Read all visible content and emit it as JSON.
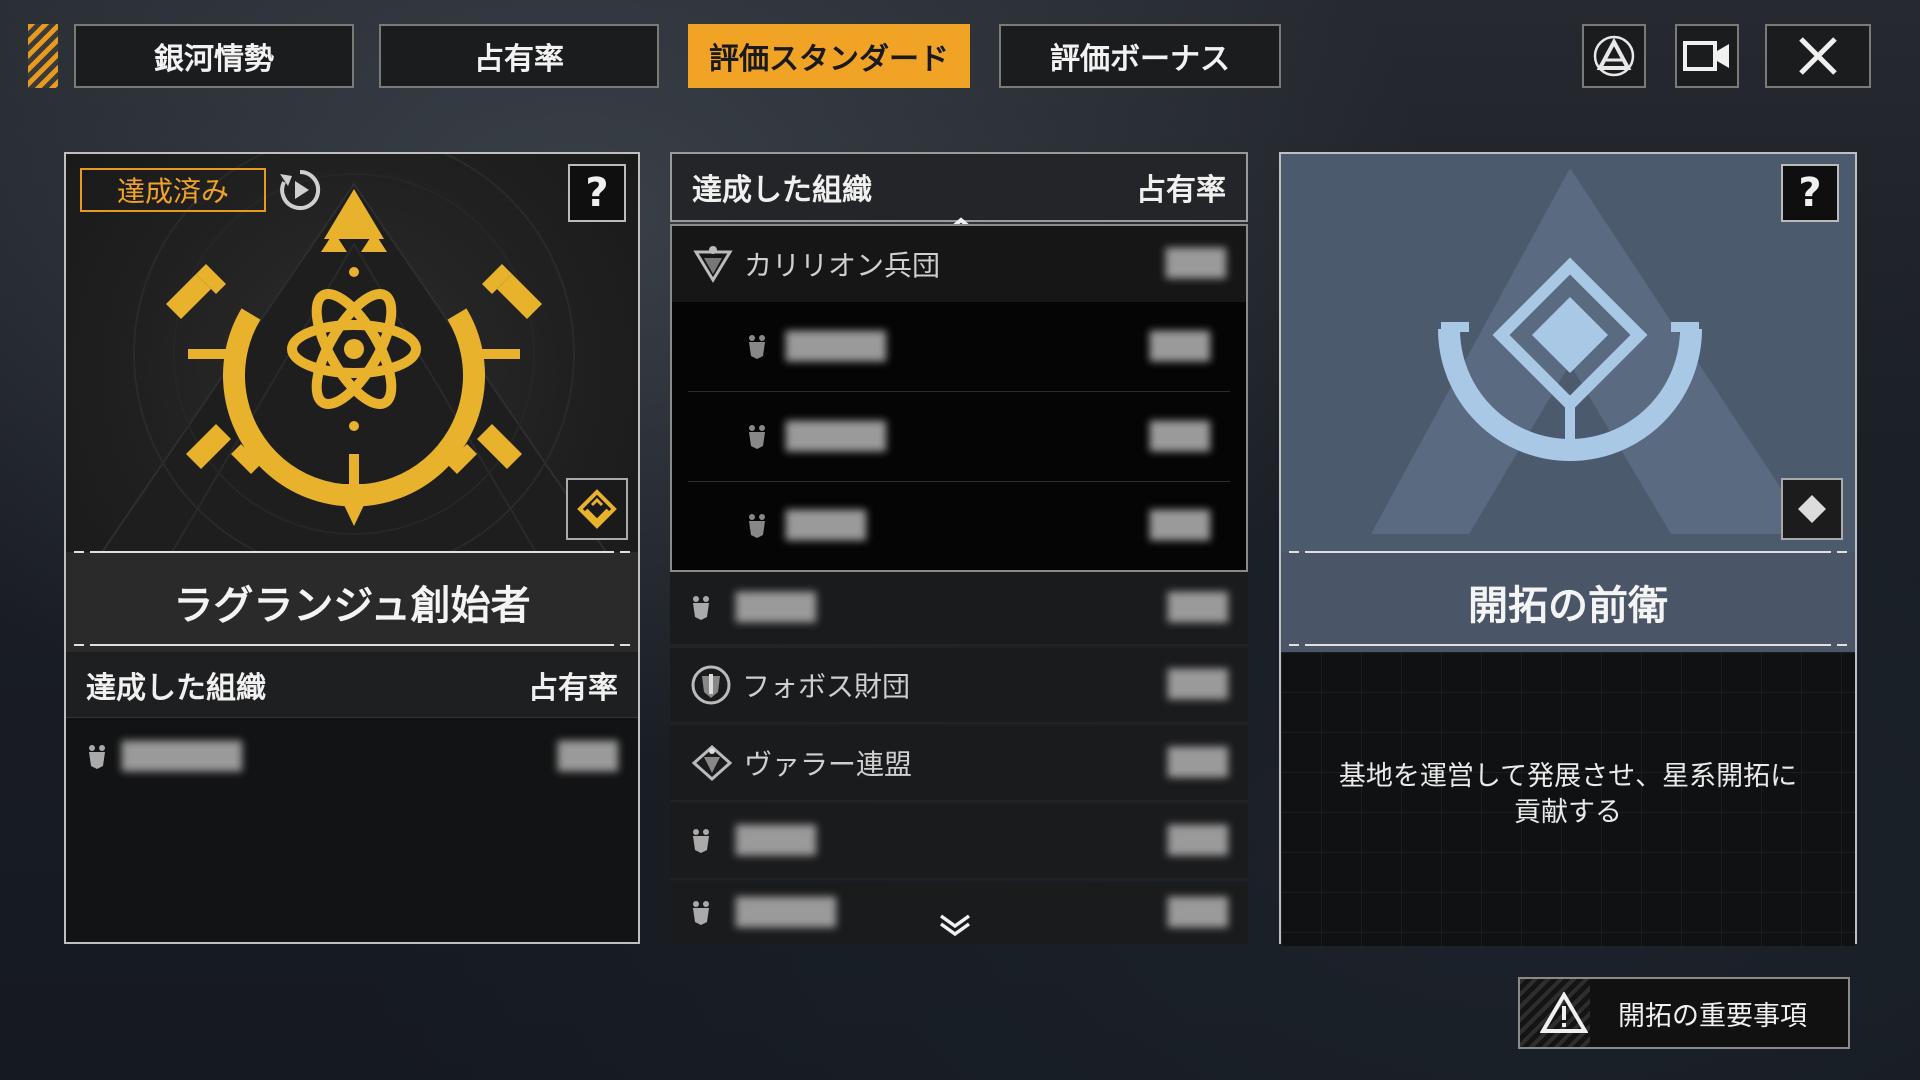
{
  "tabs": [
    {
      "label": "銀河情勢",
      "active": false
    },
    {
      "label": "占有率",
      "active": false
    },
    {
      "label": "評価スタンダード",
      "active": true
    },
    {
      "label": "評価ボーナス",
      "active": false
    }
  ],
  "colors": {
    "accent": "#f0a325",
    "panel_border": "#bfbfbf",
    "emblem_gold": "#e8b22d",
    "emblem_blue": "#a9c8e6"
  },
  "left_card": {
    "badge": "達成済み",
    "help": "?",
    "title": "ラグランジュ創始者",
    "list_header": {
      "org": "達成した組織",
      "share": "占有率"
    }
  },
  "middle_list": {
    "header": {
      "org": "達成した組織",
      "share": "占有率"
    },
    "rows": [
      {
        "name": "カリリオン兵団",
        "indent": false,
        "highlight": true
      },
      {
        "name": "",
        "indent": true
      },
      {
        "name": "",
        "indent": true
      },
      {
        "name": "",
        "indent": true
      },
      {
        "name": "",
        "indent": false
      },
      {
        "name": "フォボス財団",
        "indent": false
      },
      {
        "name": "ヴァラー連盟",
        "indent": false
      },
      {
        "name": "",
        "indent": false
      },
      {
        "name": "",
        "indent": false
      }
    ]
  },
  "right_card": {
    "help": "?",
    "title": "開拓の前衛",
    "description_line1": "基地を運営して発展させ、星系開拓に",
    "description_line2": "貢献する"
  },
  "notice_button": {
    "label": "開拓の重要事項"
  }
}
